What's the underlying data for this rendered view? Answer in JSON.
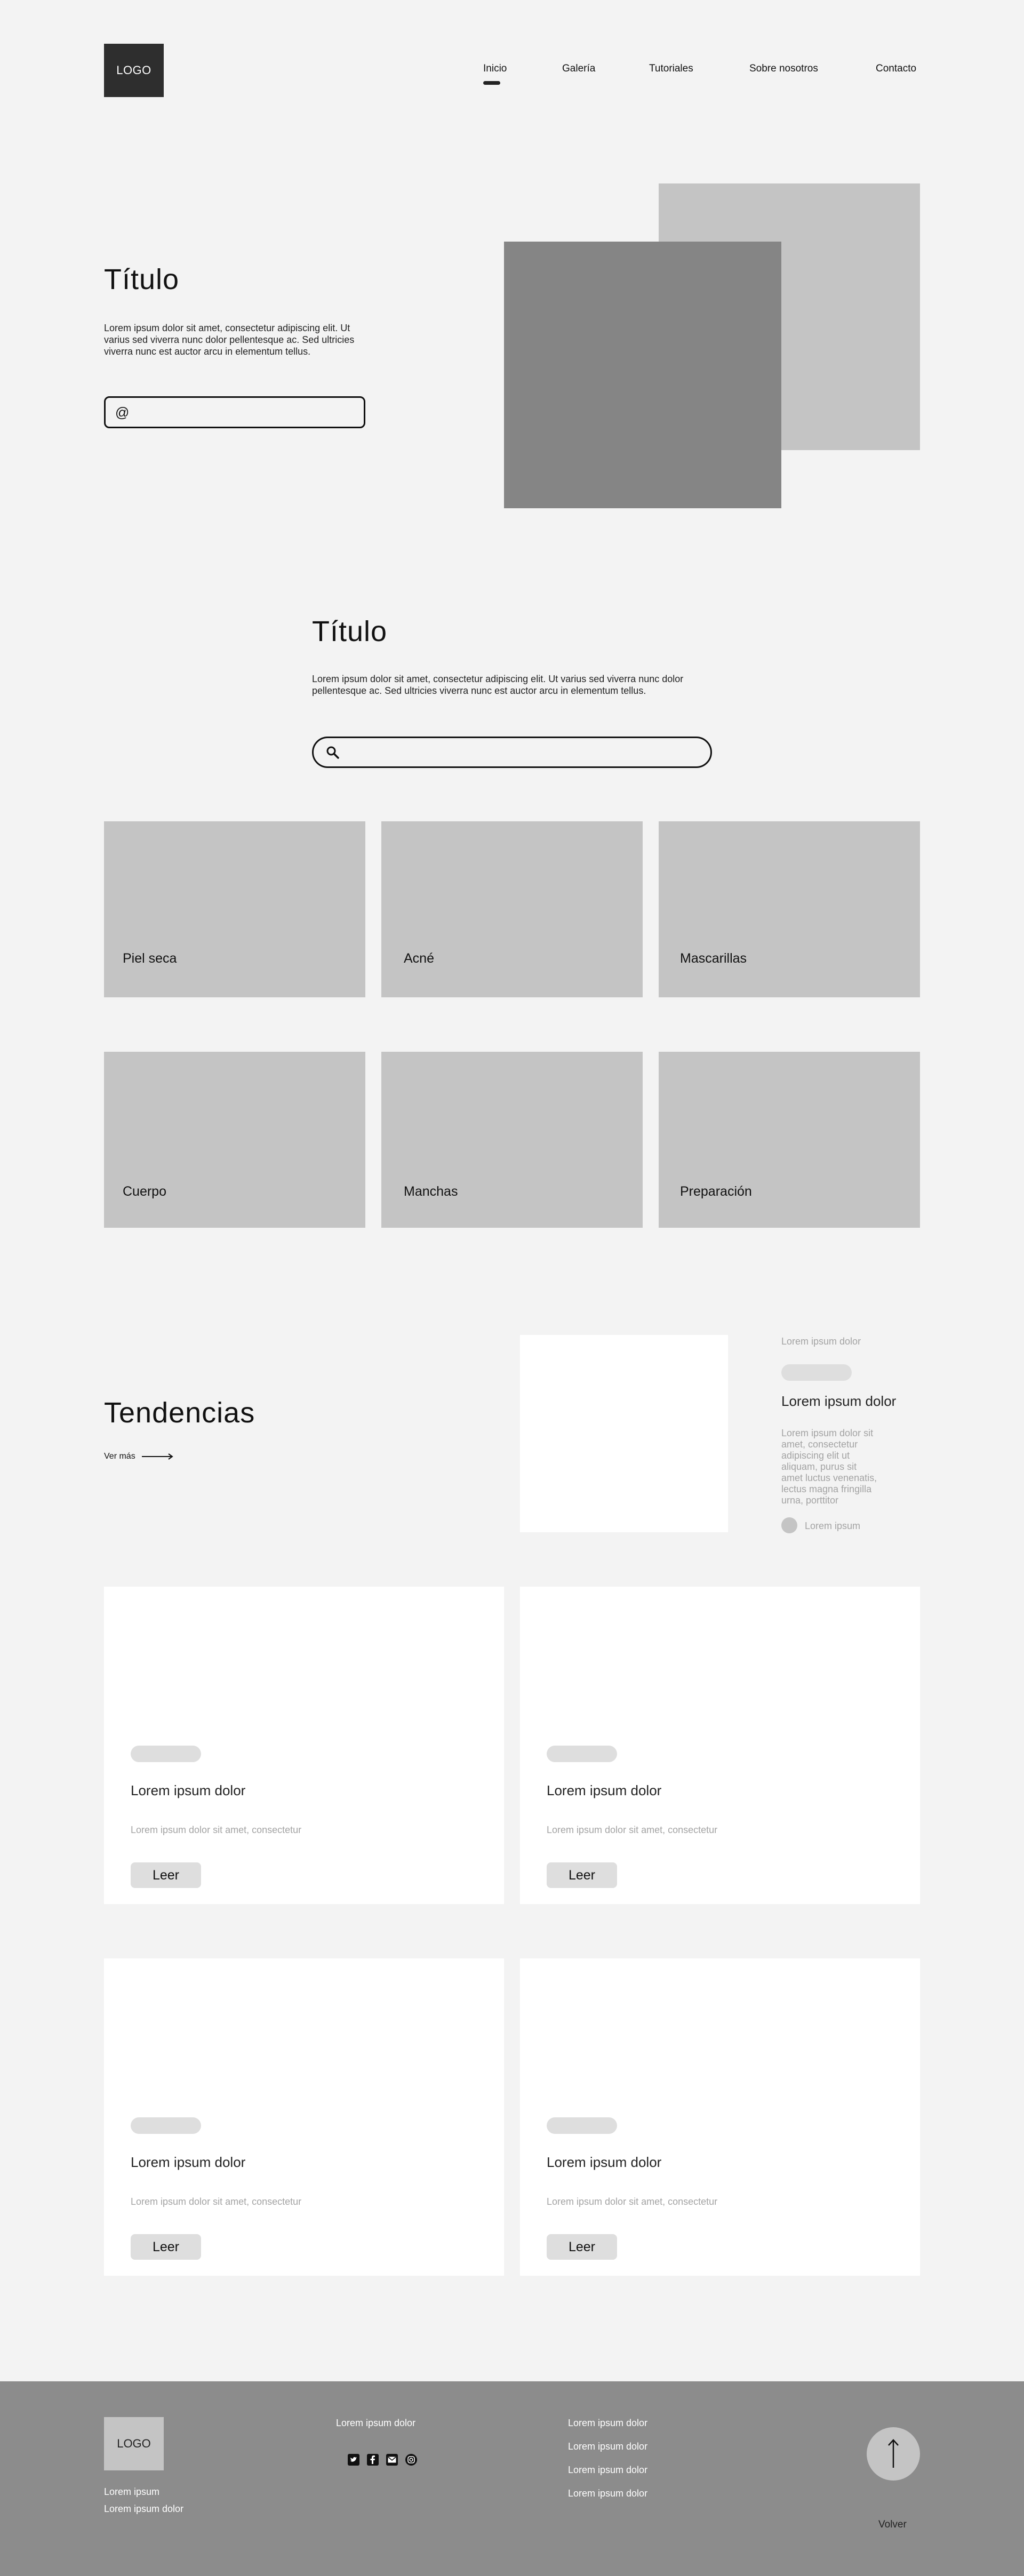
{
  "header": {
    "logo": "LOGO",
    "nav": [
      "Inicio",
      "Galería",
      "Tutoriales",
      "Sobre nosotros",
      "Contacto"
    ],
    "active": "Inicio"
  },
  "hero": {
    "title": "Título",
    "body": "Lorem ipsum dolor sit amet, consectetur adipiscing elit. Ut varius sed viverra nunc dolor pellentesque ac. Sed ultricies viverra nunc est auctor arcu in elementum tellus.",
    "input_icon": "@"
  },
  "search_section": {
    "title": "Título",
    "body": "Lorem ipsum dolor sit amet, consectetur adipiscing elit. Ut varius sed viverra nunc dolor pellentesque ac. Sed ultricies viverra nunc est auctor arcu in elementum tellus."
  },
  "categories": [
    "Piel seca",
    "Acné",
    "Mascarillas",
    "Cuerpo",
    "Manchas",
    "Preparación"
  ],
  "trends": {
    "title": "Tendencias",
    "see_more": "Ver más",
    "feature": {
      "kicker": "Lorem ipsum dolor",
      "title": "Lorem ipsum dolor",
      "body": "Lorem ipsum dolor sit amet, consectetur adipiscing elit ut aliquam, purus sit amet luctus venenatis, lectus magna fringilla urna, porttitor",
      "author": "Lorem ipsum"
    }
  },
  "cards": [
    {
      "title": "Lorem ipsum dolor",
      "subtitle": "Lorem ipsum dolor sit amet, consectetur",
      "button": "Leer"
    },
    {
      "title": "Lorem ipsum dolor",
      "subtitle": "Lorem ipsum dolor sit amet, consectetur",
      "button": "Leer"
    },
    {
      "title": "Lorem ipsum dolor",
      "subtitle": "Lorem ipsum dolor sit amet, consectetur",
      "button": "Leer"
    },
    {
      "title": "Lorem ipsum dolor",
      "subtitle": "Lorem ipsum dolor sit amet, consectetur",
      "button": "Leer"
    }
  ],
  "footer": {
    "logo": "LOGO",
    "left_lines": [
      "Lorem ipsum",
      "Lorem ipsum dolor"
    ],
    "social_heading": "Lorem ipsum dolor",
    "social_icons": [
      "twitter-icon",
      "facebook-icon",
      "mail-icon",
      "instagram-icon"
    ],
    "links": [
      "Lorem ipsum dolor",
      "Lorem ipsum dolor",
      "Lorem ipsum dolor",
      "Lorem ipsum dolor"
    ],
    "back": "Volver"
  },
  "colors": {
    "background": "#f3f3f3",
    "placeholder_light": "#c4c4c4",
    "placeholder_dark": "#858585",
    "footer": "#8c8c8c",
    "logo": "#2e2e2e"
  }
}
